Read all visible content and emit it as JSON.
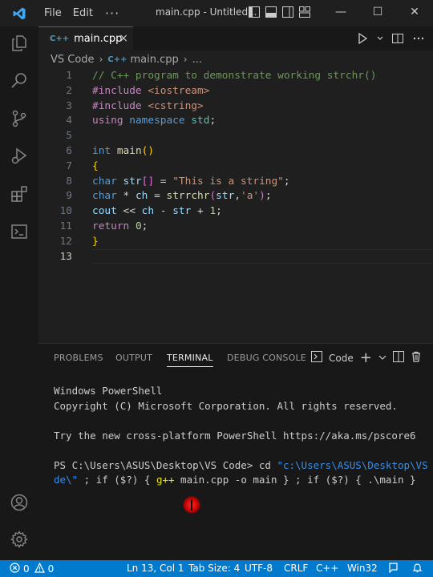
{
  "titlebar": {
    "menu": [
      "File",
      "Edit"
    ],
    "more": "···",
    "title": "main.cpp - Untitled...",
    "minimize": "—",
    "maximize": "☐",
    "close": "✕"
  },
  "tab": {
    "icon_text": "C++",
    "name": "main.cpp",
    "close": "×"
  },
  "breadcrumb": {
    "root": "VS Code",
    "icon_text": "C++",
    "file": "main.cpp",
    "more": "..."
  },
  "code": {
    "line_numbers": [
      "1",
      "2",
      "3",
      "4",
      "5",
      "6",
      "7",
      "8",
      "9",
      "10",
      "11",
      "12",
      "13"
    ],
    "active_line": 13
  },
  "panel": {
    "tabs": [
      "PROBLEMS",
      "OUTPUT",
      "TERMINAL",
      "DEBUG CONSOLE"
    ],
    "active_tab": "TERMINAL",
    "shell_label": "Code",
    "terminal": {
      "line1": "Windows PowerShell",
      "line2": "Copyright (C) Microsoft Corporation. All rights reserved.",
      "line3": "Try the new cross-platform PowerShell https://aka.ms/pscore6",
      "prompt": "PS C:\\Users\\ASUS\\Desktop\\VS Code> ",
      "cmd": "cd ",
      "path1": "\"c:\\Users\\ASUS\\Desktop\\VS Co",
      "path2": "de\\\"",
      "rest1": " ; if ($?) { ",
      "gpp": "g++",
      "gpp_args": " main.cpp -o main } ; if ($?) { .\\main }"
    }
  },
  "statusbar": {
    "errors": "0",
    "warnings": "0",
    "position": "Ln 13, Col 1",
    "tab_size": "Tab Size: 4",
    "encoding": "UTF-8",
    "eol": "CRLF",
    "language": "C++",
    "platform": "Win32"
  },
  "colors": {
    "accent": "#007acc",
    "editor_bg": "#1f1f1f",
    "panel_bg": "#181818"
  }
}
